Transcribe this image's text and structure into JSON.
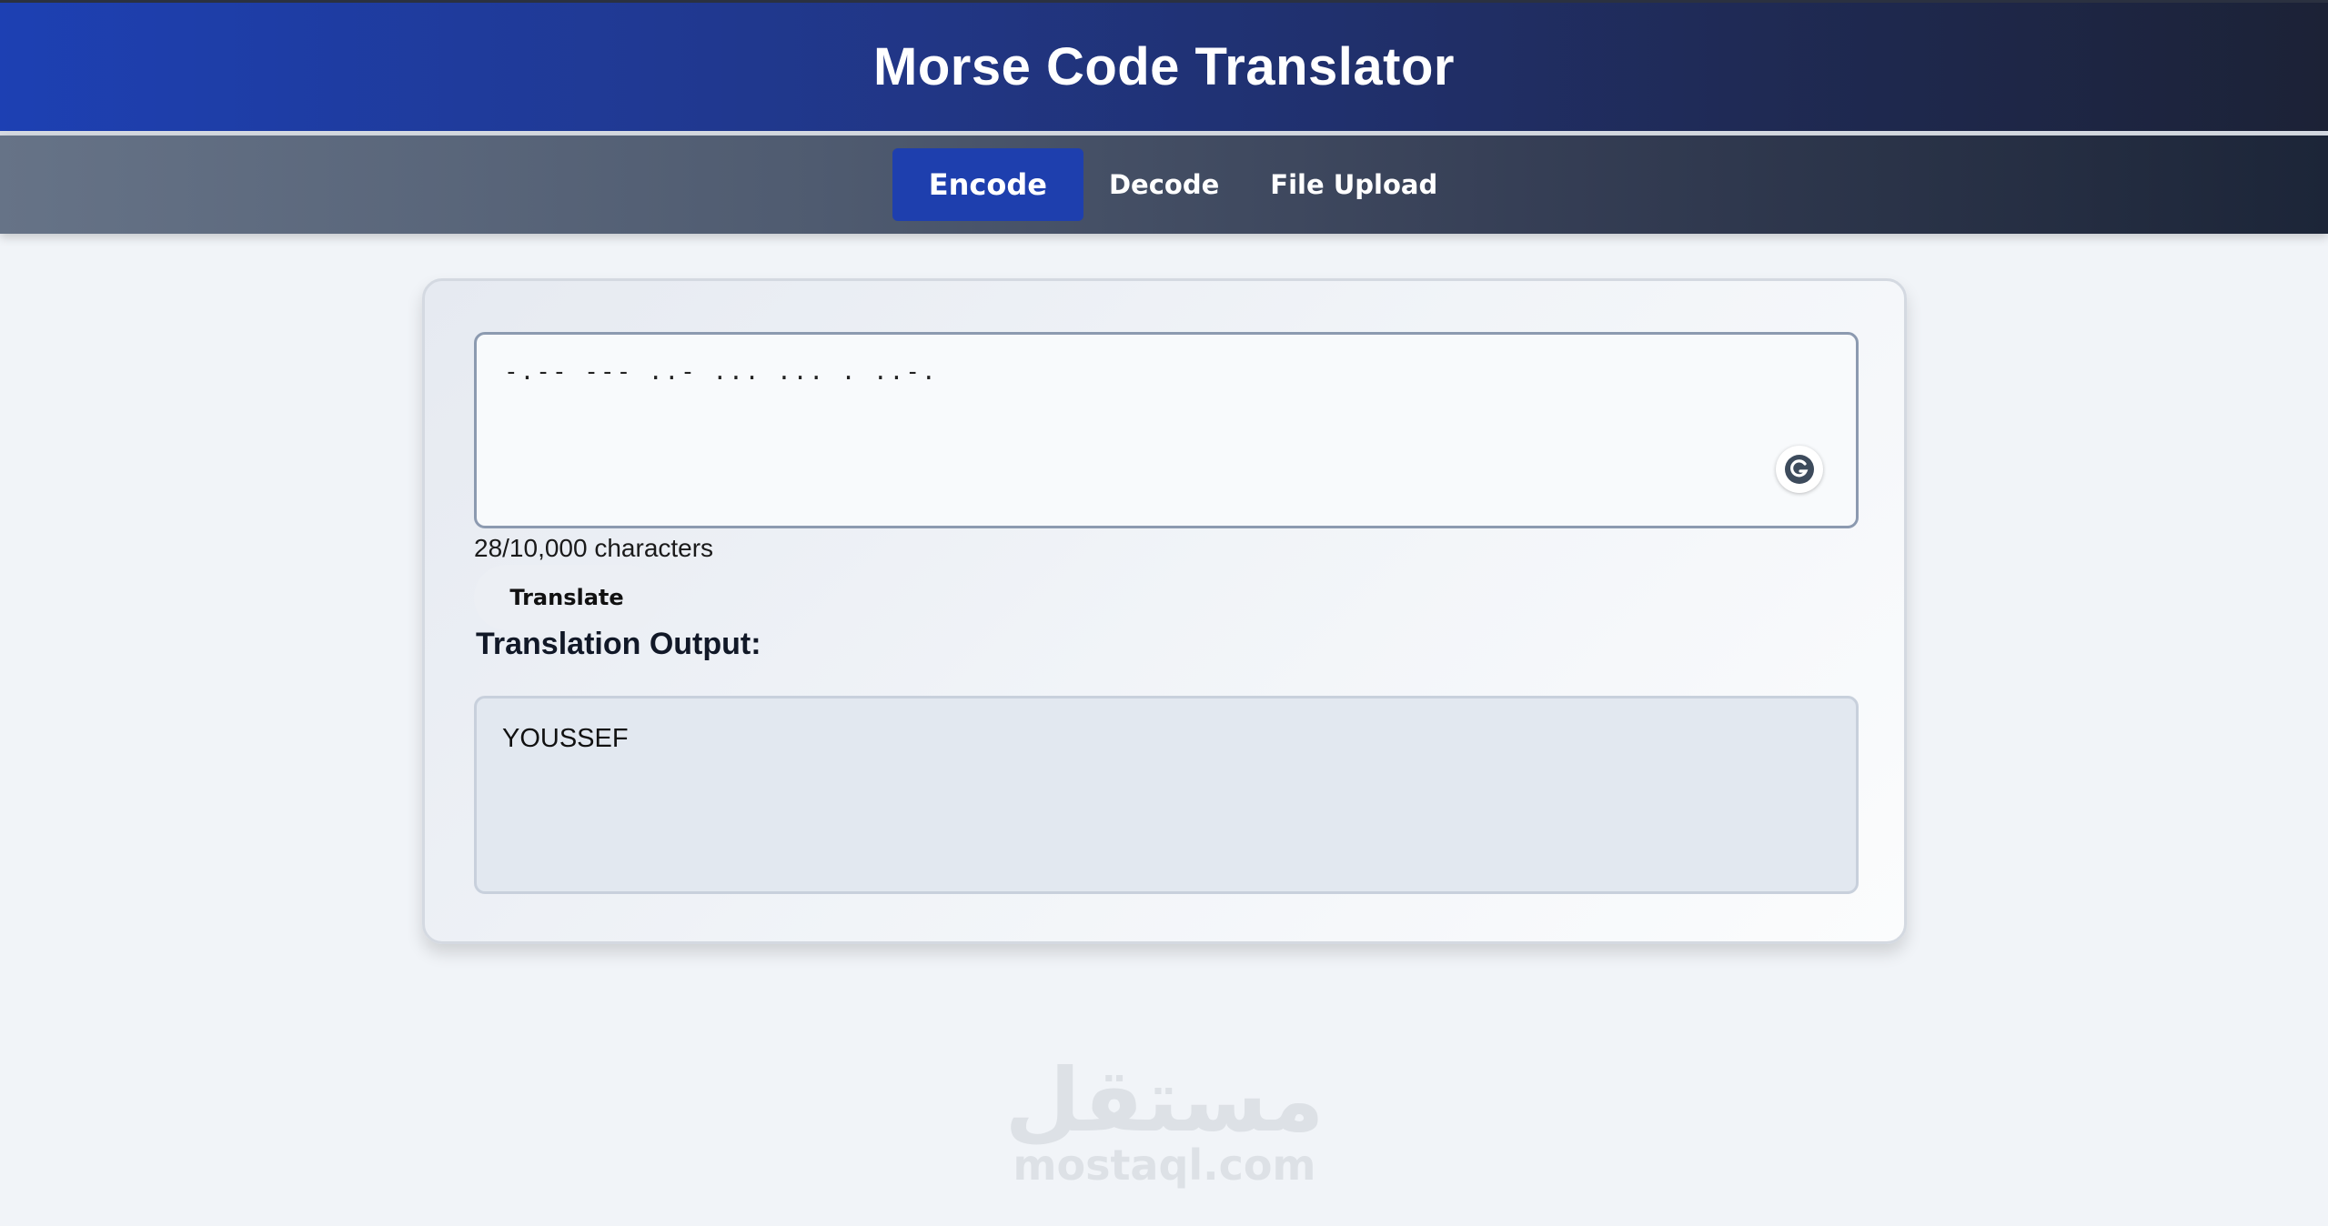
{
  "header": {
    "title": "Morse Code Translator"
  },
  "nav": {
    "tabs": [
      {
        "label": "Encode",
        "active": true
      },
      {
        "label": "Decode",
        "active": false
      },
      {
        "label": "File Upload",
        "active": false
      }
    ]
  },
  "translator": {
    "input_value": "-.-- --- ..- ... ... . ..-.",
    "char_count": "28/10,000 characters",
    "translate_label": "Translate",
    "output_title": "Translation Output:",
    "output_value": "YOUSSEF"
  },
  "icons": {
    "grammarly": "grammarly-icon"
  },
  "watermark": {
    "arabic": "مستقل",
    "latin": "mostaql.com"
  },
  "colors": {
    "accent": "#1e3fae",
    "header_start": "#1d40b3",
    "header_end": "#1c2236",
    "background": "#f1f4f8"
  }
}
